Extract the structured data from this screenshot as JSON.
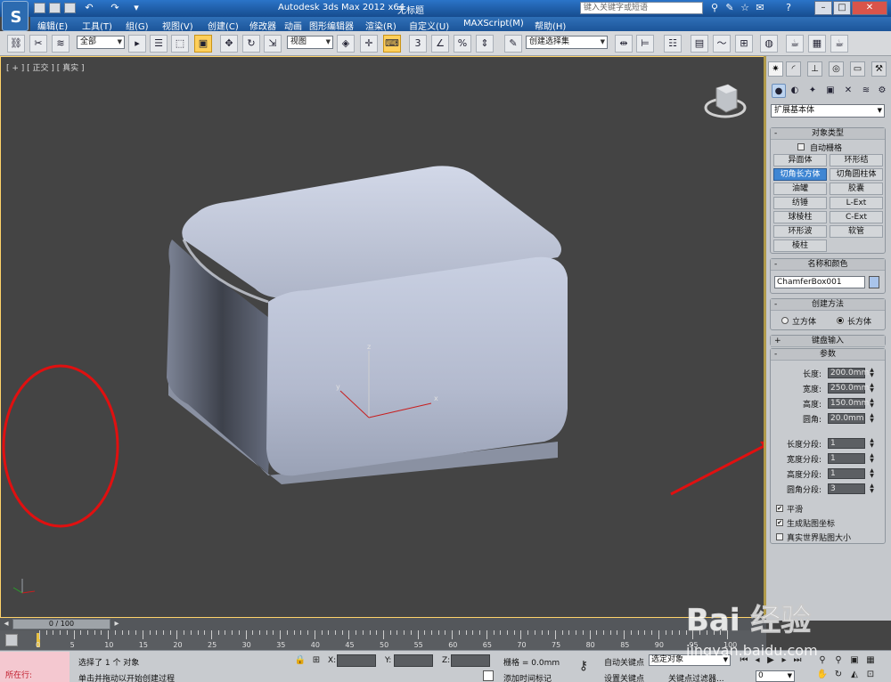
{
  "app": {
    "title": "Autodesk 3ds Max  2012 x64",
    "document": "无标题",
    "search_placeholder": "键入关键字或短语"
  },
  "menu": [
    "编辑(E)",
    "工具(T)",
    "组(G)",
    "视图(V)",
    "创建(C)",
    "修改器",
    "动画",
    "图形编辑器",
    "渲染(R)",
    "自定义(U)",
    "MAXScript(M)",
    "帮助(H)"
  ],
  "toolbar": {
    "selection_filter": "全部",
    "ref_coord": "视图",
    "named_selection": "创建选择集",
    "snap_label": "3",
    "percent_label": "%"
  },
  "viewport": {
    "label": "[ + ] [ 正交 ] [ 真实 ]",
    "axis_x": "x",
    "axis_y": "y",
    "axis_z": "z"
  },
  "command_panel": {
    "category": "扩展基本体",
    "object_type": {
      "header": "对象类型",
      "autogrid": "自动栅格",
      "buttons": [
        "异面体",
        "环形结",
        "切角长方体",
        "切角圆柱体",
        "油罐",
        "胶囊",
        "纺锤",
        "L-Ext",
        "球棱柱",
        "C-Ext",
        "环形波",
        "软管",
        "棱柱"
      ],
      "active": "切角长方体"
    },
    "name_color": {
      "header": "名称和颜色",
      "name": "ChamferBox001",
      "color": "#a9c4ea"
    },
    "creation_method": {
      "header": "创建方法",
      "options": [
        "立方体",
        "长方体"
      ],
      "selected": "长方体"
    },
    "keyboard_entry": {
      "header": "键盘输入"
    },
    "parameters": {
      "header": "参数",
      "length_label": "长度:",
      "length": "200.0mm",
      "width_label": "宽度:",
      "width": "250.0mm",
      "height_label": "高度:",
      "height": "150.0mm",
      "fillet_label": "圆角:",
      "fillet": "20.0mm",
      "length_segs_label": "长度分段:",
      "length_segs": "1",
      "width_segs_label": "宽度分段:",
      "width_segs": "1",
      "height_segs_label": "高度分段:",
      "height_segs": "1",
      "fillet_segs_label": "圆角分段:",
      "fillet_segs": "3",
      "smooth": "平滑",
      "gen_mapping": "生成贴图坐标",
      "real_world": "真实世界贴图大小"
    }
  },
  "timeline": {
    "frame": "0 / 100",
    "ticks": [
      "0",
      "5",
      "10",
      "15",
      "20",
      "25",
      "30",
      "35",
      "40",
      "45",
      "50",
      "55",
      "60",
      "65",
      "70",
      "75",
      "80",
      "85",
      "90",
      "95",
      "100"
    ]
  },
  "status": {
    "mode": "所在行:",
    "message1": "选择了 1 个 对象",
    "message2": "单击并拖动以开始创建过程",
    "x_label": "X:",
    "y_label": "Y:",
    "z_label": "Z:",
    "grid": "栅格 = 0.0mm",
    "add_time_tag": "添加时间标记",
    "auto_key": "自动关键点",
    "set_key": "设置关键点",
    "selected_obj": "选定对象",
    "key_filters": "关键点过滤器...",
    "frame_field": "0"
  },
  "watermark": {
    "logo": "Bai 经验",
    "url": "jingyan.baidu.com"
  },
  "colors": {
    "accent": "#ffcf5a",
    "annotation_red": "#e01010",
    "viewport_bg": "#444444"
  }
}
